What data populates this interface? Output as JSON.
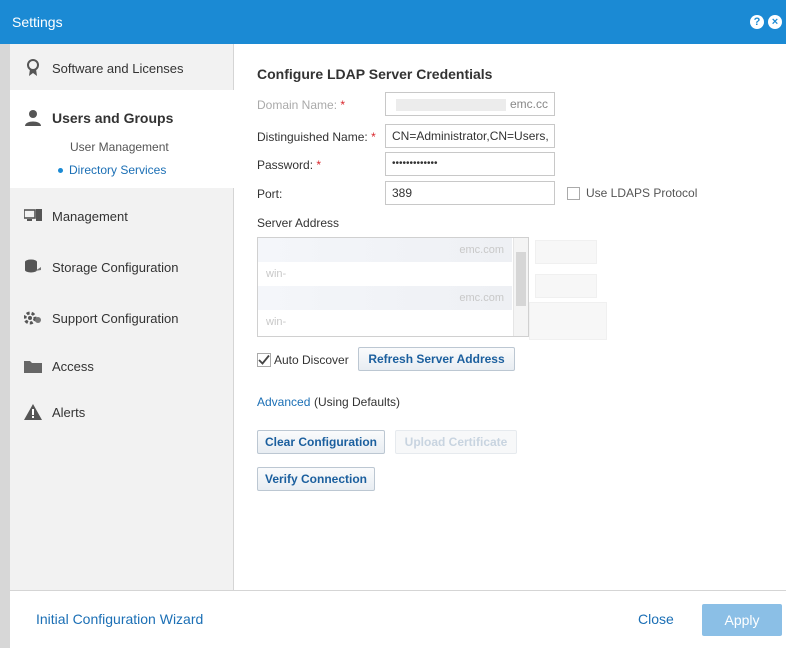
{
  "window": {
    "title": "Settings",
    "help_glyph": "?",
    "close_glyph": "×"
  },
  "sidebar": {
    "items": [
      {
        "label": "Software and Licenses",
        "icon": "award-icon"
      },
      {
        "label": "Users and Groups",
        "icon": "user-icon"
      },
      {
        "label": "Management",
        "icon": "monitor-icon"
      },
      {
        "label": "Storage Configuration",
        "icon": "storage-icon"
      },
      {
        "label": "Support Configuration",
        "icon": "gears-icon"
      },
      {
        "label": "Access",
        "icon": "folder-icon"
      },
      {
        "label": "Alerts",
        "icon": "warning-icon"
      }
    ],
    "sub_items": [
      {
        "label": "User Management"
      },
      {
        "label": "Directory Services"
      }
    ]
  },
  "form": {
    "heading": "Configure LDAP Server Credentials",
    "domain_name": {
      "label": "Domain Name:",
      "required": "*",
      "value": "emc.cc"
    },
    "distinguished_name": {
      "label": "Distinguished Name:",
      "required": "*",
      "value": "CN=Administrator,CN=Users,"
    },
    "password": {
      "label": "Password:",
      "required": "*",
      "value": "•••••••••••••"
    },
    "port": {
      "label": "Port:",
      "value": "389"
    },
    "ldaps": {
      "label": "Use LDAPS Protocol",
      "checked": false
    },
    "server_address": {
      "label": "Server Address",
      "rows": [
        "emc.com",
        "win-",
        "emc.com",
        "win-"
      ]
    },
    "auto_discover": {
      "label": "Auto Discover",
      "checked": true
    },
    "refresh_button": "Refresh Server Address",
    "advanced_link": "Advanced",
    "advanced_note": "(Using Defaults)",
    "clear_button": "Clear Configuration",
    "upload_button": "Upload Certificate",
    "verify_button": "Verify Connection"
  },
  "footer": {
    "wizard_link": "Initial Configuration Wizard",
    "close_link": "Close",
    "apply_button": "Apply"
  },
  "colors": {
    "accent": "#1b8ad4",
    "link": "#1b6fb5",
    "required": "#d9262c",
    "apply_disabled": "#8bbfe6"
  }
}
